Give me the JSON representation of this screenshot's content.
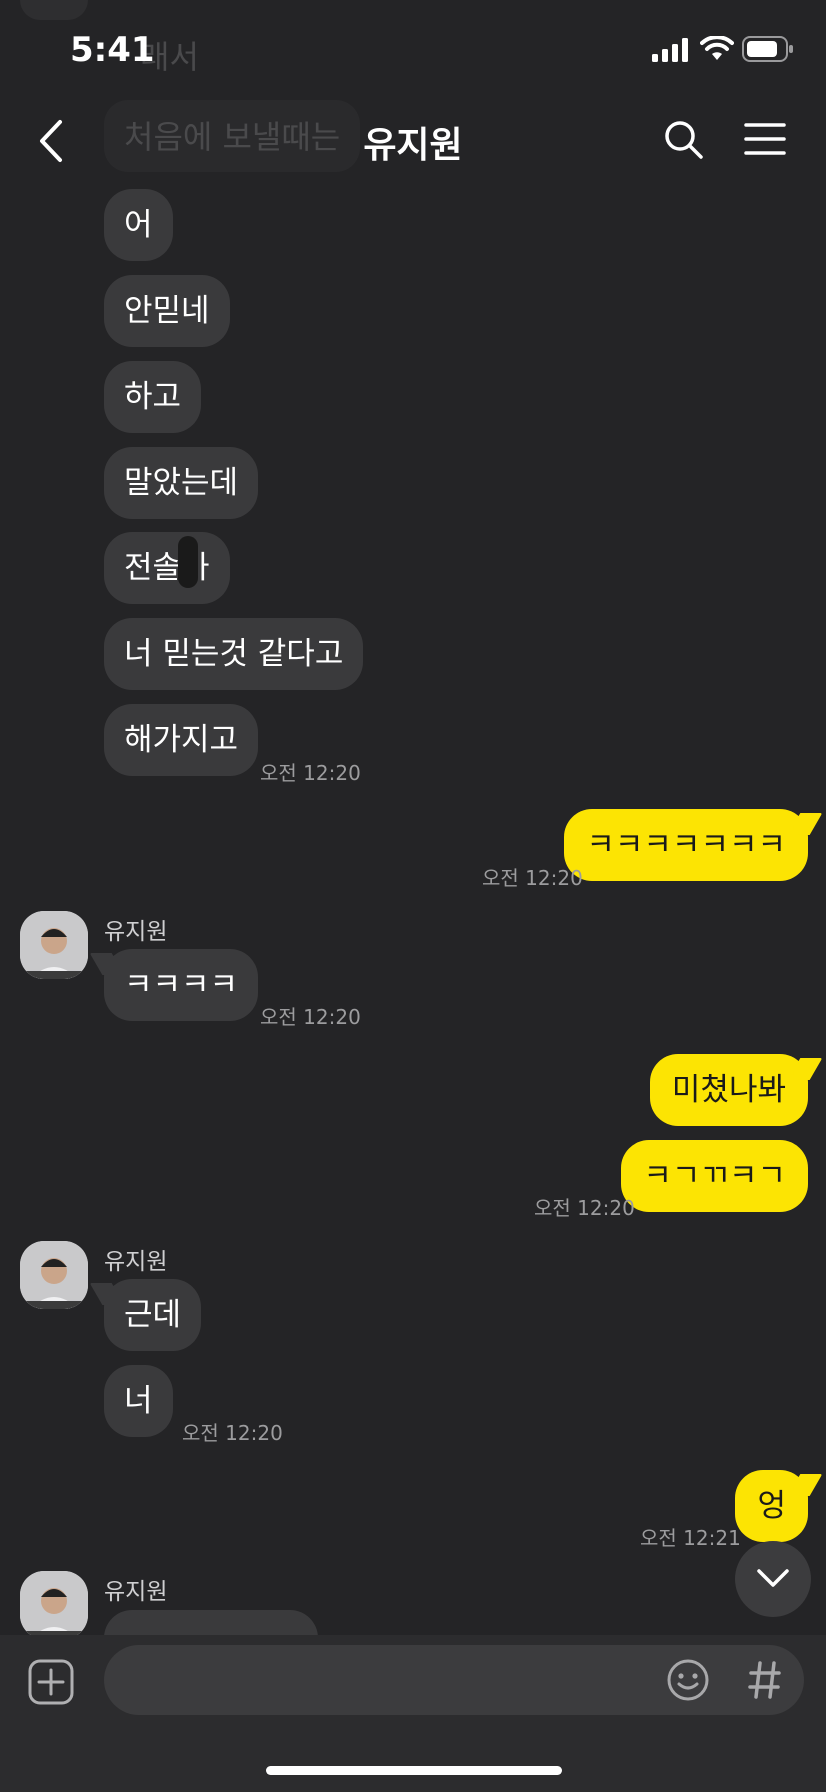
{
  "status_bar": {
    "time": "5:41"
  },
  "faded_behind_header": [
    "래서",
    "처음에 보낼때는"
  ],
  "header": {
    "title": "유지원"
  },
  "messages_block_1": {
    "bubbles": [
      "어",
      "안믿네",
      "하고",
      "말았는데",
      "전솔가",
      "너 믿는것 같다고",
      "해가지고"
    ],
    "time": "오전 12:20"
  },
  "out_1": {
    "text": "ㅋㅋㅋㅋㅋㅋㅋ",
    "time": "오전 12:20"
  },
  "in_2": {
    "sender": "유지원",
    "text": "ㅋㅋㅋㅋ",
    "time": "오전 12:20"
  },
  "out_2": {
    "texts": [
      "미쳤나봐",
      "ㅋㄱㄲㅋㄱ"
    ],
    "time": "오전 12:20"
  },
  "in_3": {
    "sender": "유지원",
    "texts": [
      "근데",
      "너"
    ],
    "time": "오전 12:20"
  },
  "out_3": {
    "text": "엉",
    "time": "오전 12:21"
  },
  "in_4": {
    "sender": "유지원"
  },
  "icons": {
    "back": "chevron-left-icon",
    "search": "search-icon",
    "menu": "menu-icon",
    "add": "plus-square-icon",
    "emoji": "emoji-icon",
    "hashtag": "hashtag-icon",
    "scroll": "chevron-down-icon"
  },
  "colors": {
    "background": "#242426",
    "incoming_bubble": "#3a3a3c",
    "outgoing_bubble": "#fce403"
  }
}
